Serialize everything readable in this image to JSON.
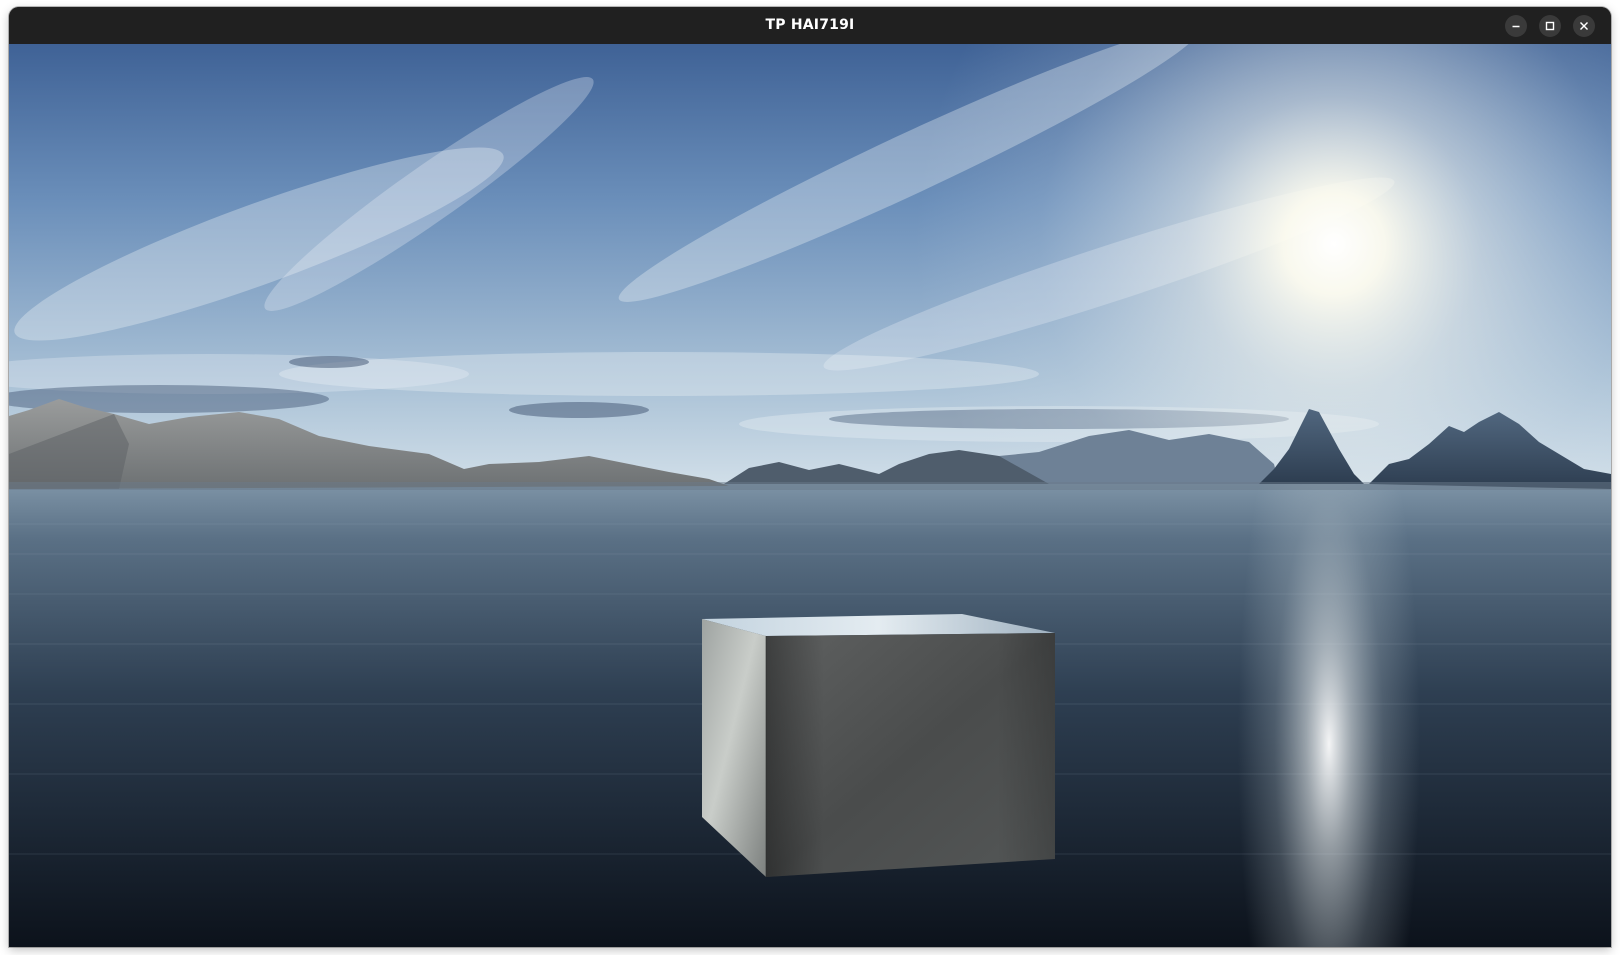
{
  "window": {
    "title": "TP HAI719I",
    "controls": {
      "minimize": "minimize-icon",
      "maximize": "maximize-icon",
      "close": "close-icon"
    }
  },
  "scene": {
    "sky_top": "#4a6d9c",
    "sky_horizon": "#c9d9e6",
    "sun_color": "#fffdf2",
    "water_far": "#5d7488",
    "water_near": "#101722",
    "mountain_left": "#8a8a88",
    "mountain_right": "#42566e",
    "cube_light": "#c4c8c6",
    "cube_dark": "#4f5050"
  }
}
